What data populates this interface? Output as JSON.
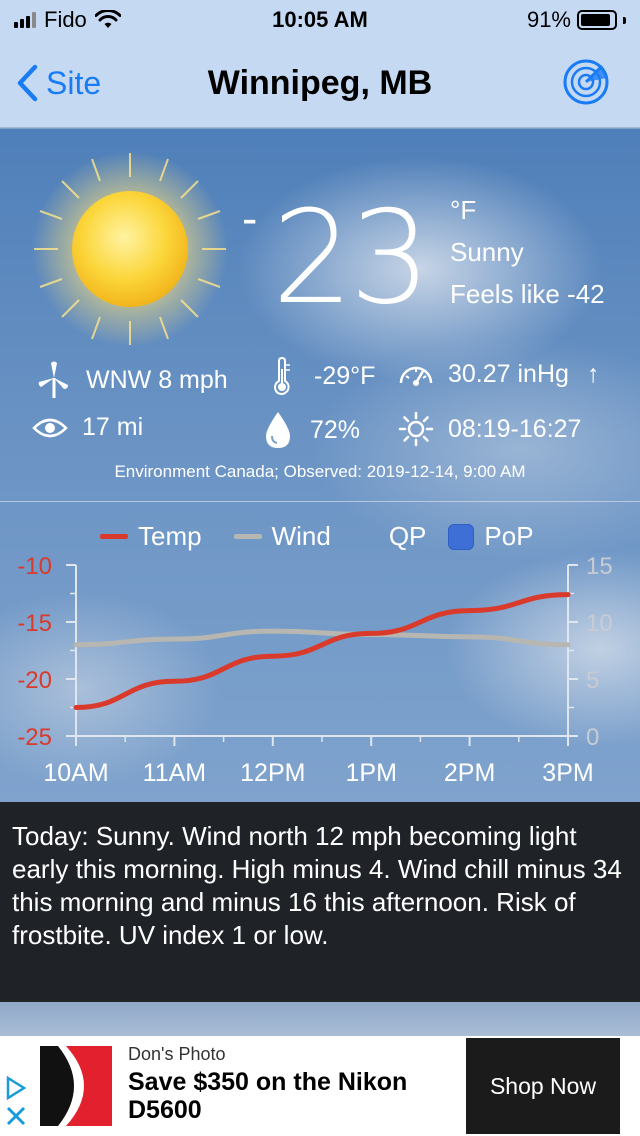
{
  "status_bar": {
    "carrier": "Fido",
    "time": "10:05 AM",
    "battery_percent": "91%"
  },
  "nav": {
    "back_label": "Site",
    "title": "Winnipeg, MB",
    "radar_icon": "radar-icon"
  },
  "current": {
    "minus": "-",
    "temperature": "23",
    "unit": "°F",
    "condition": "Sunny",
    "feels_like": "Feels like -42"
  },
  "details": {
    "wind": "WNW 8 mph",
    "visibility": "17 mi",
    "dewpoint": "-29°F",
    "humidity": "72%",
    "pressure": "30.27 inHg",
    "pressure_trend": "↑",
    "sun_times": "08:19-16:27"
  },
  "source": "Environment Canada; Observed: 2019-12-14, 9:00 AM",
  "legend": {
    "temp": "Temp",
    "wind": "Wind",
    "qp": "QP",
    "pop": "PoP"
  },
  "colors": {
    "temp_line": "#d93a2b",
    "wind_line": "#b8b6b0",
    "pop_box": "#3d6fd6",
    "link_blue": "#1a7cf5"
  },
  "chart_data": {
    "type": "line",
    "categories": [
      "10AM",
      "11AM",
      "12PM",
      "1PM",
      "2PM",
      "3PM"
    ],
    "left_axis": {
      "ticks": [
        "-10",
        "-15",
        "-20",
        "-25"
      ],
      "range": [
        -25,
        -10
      ],
      "color": "#d93a2b"
    },
    "right_axis": {
      "ticks": [
        "15",
        "10",
        "5",
        "0"
      ],
      "range": [
        0,
        15
      ],
      "color": "#c8ccd2"
    },
    "series": [
      {
        "name": "Temp",
        "axis": "left",
        "values": [
          -22.5,
          -20.2,
          -18.0,
          -16.0,
          -14.0,
          -12.6
        ]
      },
      {
        "name": "Wind",
        "axis": "right",
        "values": [
          8.0,
          8.5,
          9.2,
          8.9,
          8.7,
          8.0
        ]
      }
    ]
  },
  "forecast_text": "Today:  Sunny. Wind north 12 mph becoming light early this morning. High minus 4. Wind chill minus 34 this morning and minus 16 this afternoon. Risk of frostbite. UV index 1 or low.",
  "ad": {
    "sponsor": "Don's Photo",
    "headline": "Save $350 on the Nikon D5600",
    "cta": "Shop Now"
  }
}
